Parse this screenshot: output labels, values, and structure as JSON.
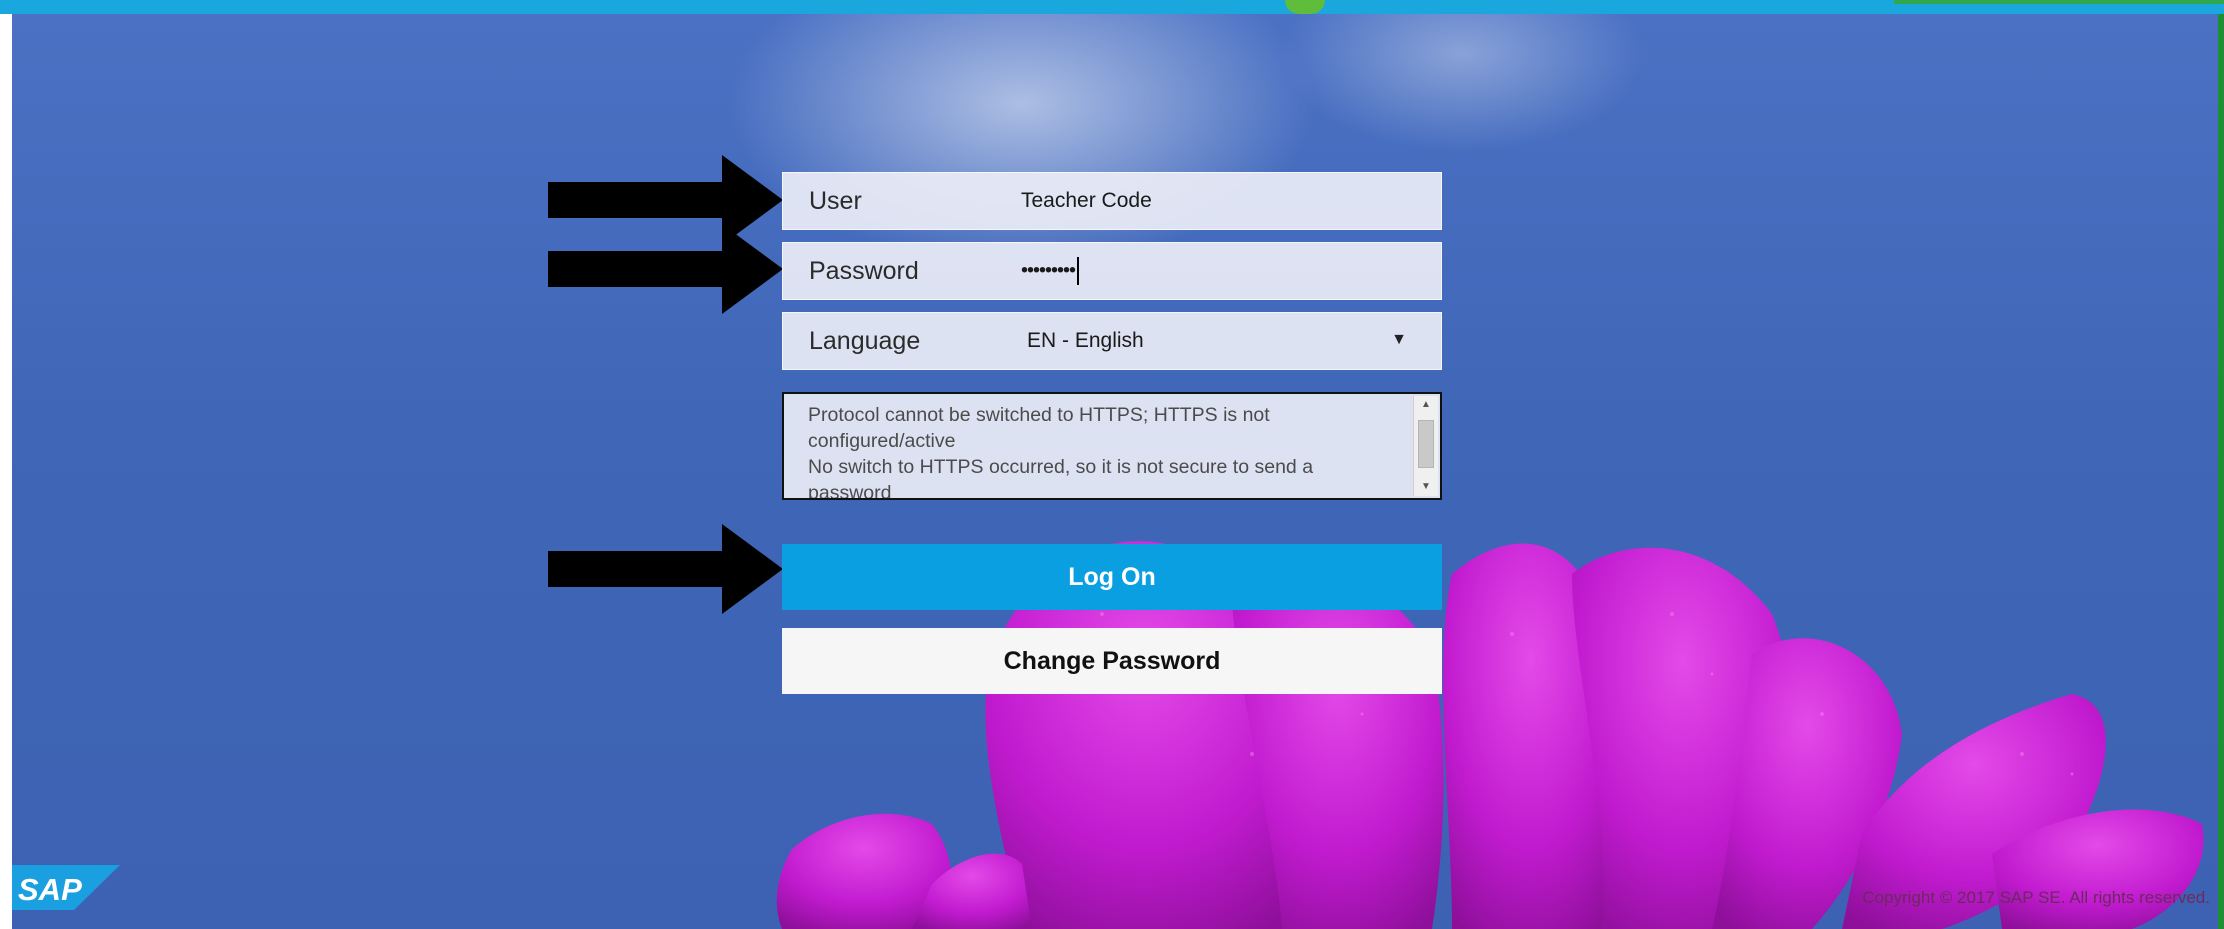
{
  "form": {
    "user_label": "User",
    "user_value": "Teacher Code",
    "password_label": "Password",
    "password_value": "•••••••••",
    "language_label": "Language",
    "language_value": "EN - English",
    "message_lines": [
      "Protocol cannot be switched to HTTPS; HTTPS is not configured/active",
      "No switch to HTTPS occurred, so it is not secure to send a password"
    ],
    "logon_label": "Log On",
    "change_password_label": "Change Password"
  },
  "footer": {
    "logo_text": "SAP",
    "copyright": "Copyright © 2017 SAP SE. All rights reserved."
  },
  "colors": {
    "primary_button": "#0a9fe0",
    "sky": "#3f66b7",
    "flower": "#c21bd0"
  },
  "icons": [
    "arrow-right-icon",
    "dropdown-arrow-icon",
    "scroll-up-icon",
    "scroll-down-icon"
  ]
}
